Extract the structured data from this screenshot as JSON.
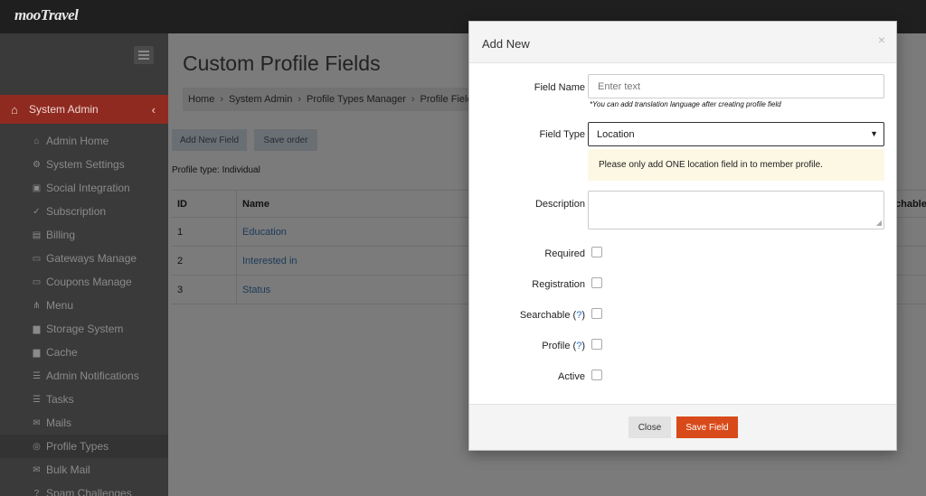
{
  "app": {
    "brand": "mooTravel"
  },
  "sidebar": {
    "section_label": "System Admin",
    "items": [
      {
        "icon": "home-icon",
        "label": "Admin Home"
      },
      {
        "icon": "gear-icon",
        "label": "System Settings"
      },
      {
        "icon": "share-icon",
        "label": "Social Integration"
      },
      {
        "icon": "check-icon",
        "label": "Subscription"
      },
      {
        "icon": "document-icon",
        "label": "Billing"
      },
      {
        "icon": "card-icon",
        "label": "Gateways Manage"
      },
      {
        "icon": "ticket-icon",
        "label": "Coupons Manage"
      },
      {
        "icon": "sitemap-icon",
        "label": "Menu"
      },
      {
        "icon": "storage-icon",
        "label": "Storage System"
      },
      {
        "icon": "file-icon",
        "label": "Cache"
      },
      {
        "icon": "list-icon",
        "label": "Admin Notifications"
      },
      {
        "icon": "tasks-icon",
        "label": "Tasks"
      },
      {
        "icon": "mail-icon",
        "label": "Mails"
      },
      {
        "icon": "check-circle-icon",
        "label": "Profile Types"
      },
      {
        "icon": "envelope-icon",
        "label": "Bulk Mail"
      },
      {
        "icon": "question-icon",
        "label": "Spam Challenges"
      }
    ]
  },
  "main": {
    "title": "Custom Profile Fields",
    "breadcrumb": [
      "Home",
      "System Admin",
      "Profile Types Manager",
      "Profile Fields"
    ],
    "buttons": {
      "add_new": "Add New Field",
      "save_order": "Save order"
    },
    "profile_type": "Profile type: Individual",
    "table": {
      "headers": {
        "id": "ID",
        "name": "Name",
        "searchable": "chable"
      },
      "rows": [
        {
          "id": "1",
          "name": "Education"
        },
        {
          "id": "2",
          "name": "Interested in"
        },
        {
          "id": "3",
          "name": "Status"
        }
      ]
    }
  },
  "modal": {
    "title": "Add New",
    "close_symbol": "×",
    "field_name_label": "Field Name",
    "field_name_placeholder": "Enter text",
    "hint": "*You can add translation language after creating profile field",
    "field_type_label": "Field Type",
    "field_type_value": "Location",
    "notice": "Please only add ONE location field in to member profile.",
    "description_label": "Description",
    "checkboxes": {
      "required": "Required",
      "registration": "Registration",
      "searchable": "Searchable",
      "profile": "Profile",
      "active": "Active",
      "help_mark": "?"
    },
    "close_button": "Close",
    "save_button": "Save Field"
  },
  "colors": {
    "accent": "#d94a1a",
    "sidebar_active": "#8f2a20",
    "notice_bg": "#fcf8e3"
  }
}
